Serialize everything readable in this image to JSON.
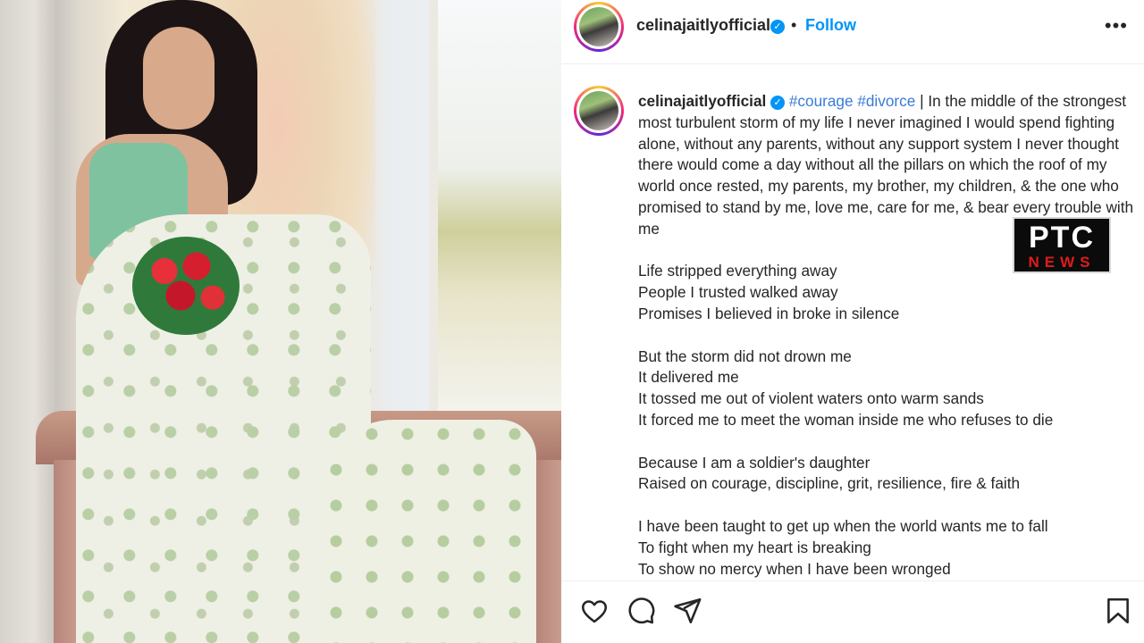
{
  "header": {
    "username": "celinajaitlyofficial",
    "separator": "•",
    "follow_label": "Follow",
    "more_label": "•••"
  },
  "caption": {
    "username": "celinajaitlyofficial",
    "hashtags": [
      "#courage",
      "#divorce"
    ],
    "separator": "|",
    "intro": "In the middle of the strongest most turbulent storm of my life I never imagined I would spend fighting alone, without any parents, without any support system I never thought there would come a day without all the pillars on which the roof of my world once rested, my parents, my brother, my children, & the one who promised to stand by me, love me, care for me, & bear every trouble with me",
    "stanza1": [
      "Life stripped everything away",
      "People I trusted walked away",
      "Promises I believed in broke in silence"
    ],
    "stanza2": [
      "But the storm did not drown me",
      "It delivered me",
      "It tossed me out of violent waters onto warm sands",
      "It forced me to meet the woman inside me who refuses to die"
    ],
    "stanza3": [
      "Because I am a soldier's daughter",
      "Raised on courage, discipline, grit, resilience, fire & faith"
    ],
    "stanza4": [
      "I have been taught to get up when the world wants me to fall",
      "To fight when my heart is breaking",
      "To show no mercy when I have been wronged"
    ]
  },
  "watermark": {
    "top": "PTC",
    "bottom": "NEWS"
  },
  "icons": {
    "verified": "verified-badge",
    "like": "heart-icon",
    "comment": "comment-icon",
    "share": "send-icon",
    "save": "bookmark-icon"
  },
  "colors": {
    "link_blue": "#0095f6",
    "hashtag": "#3a7ad6",
    "text": "#262626"
  }
}
